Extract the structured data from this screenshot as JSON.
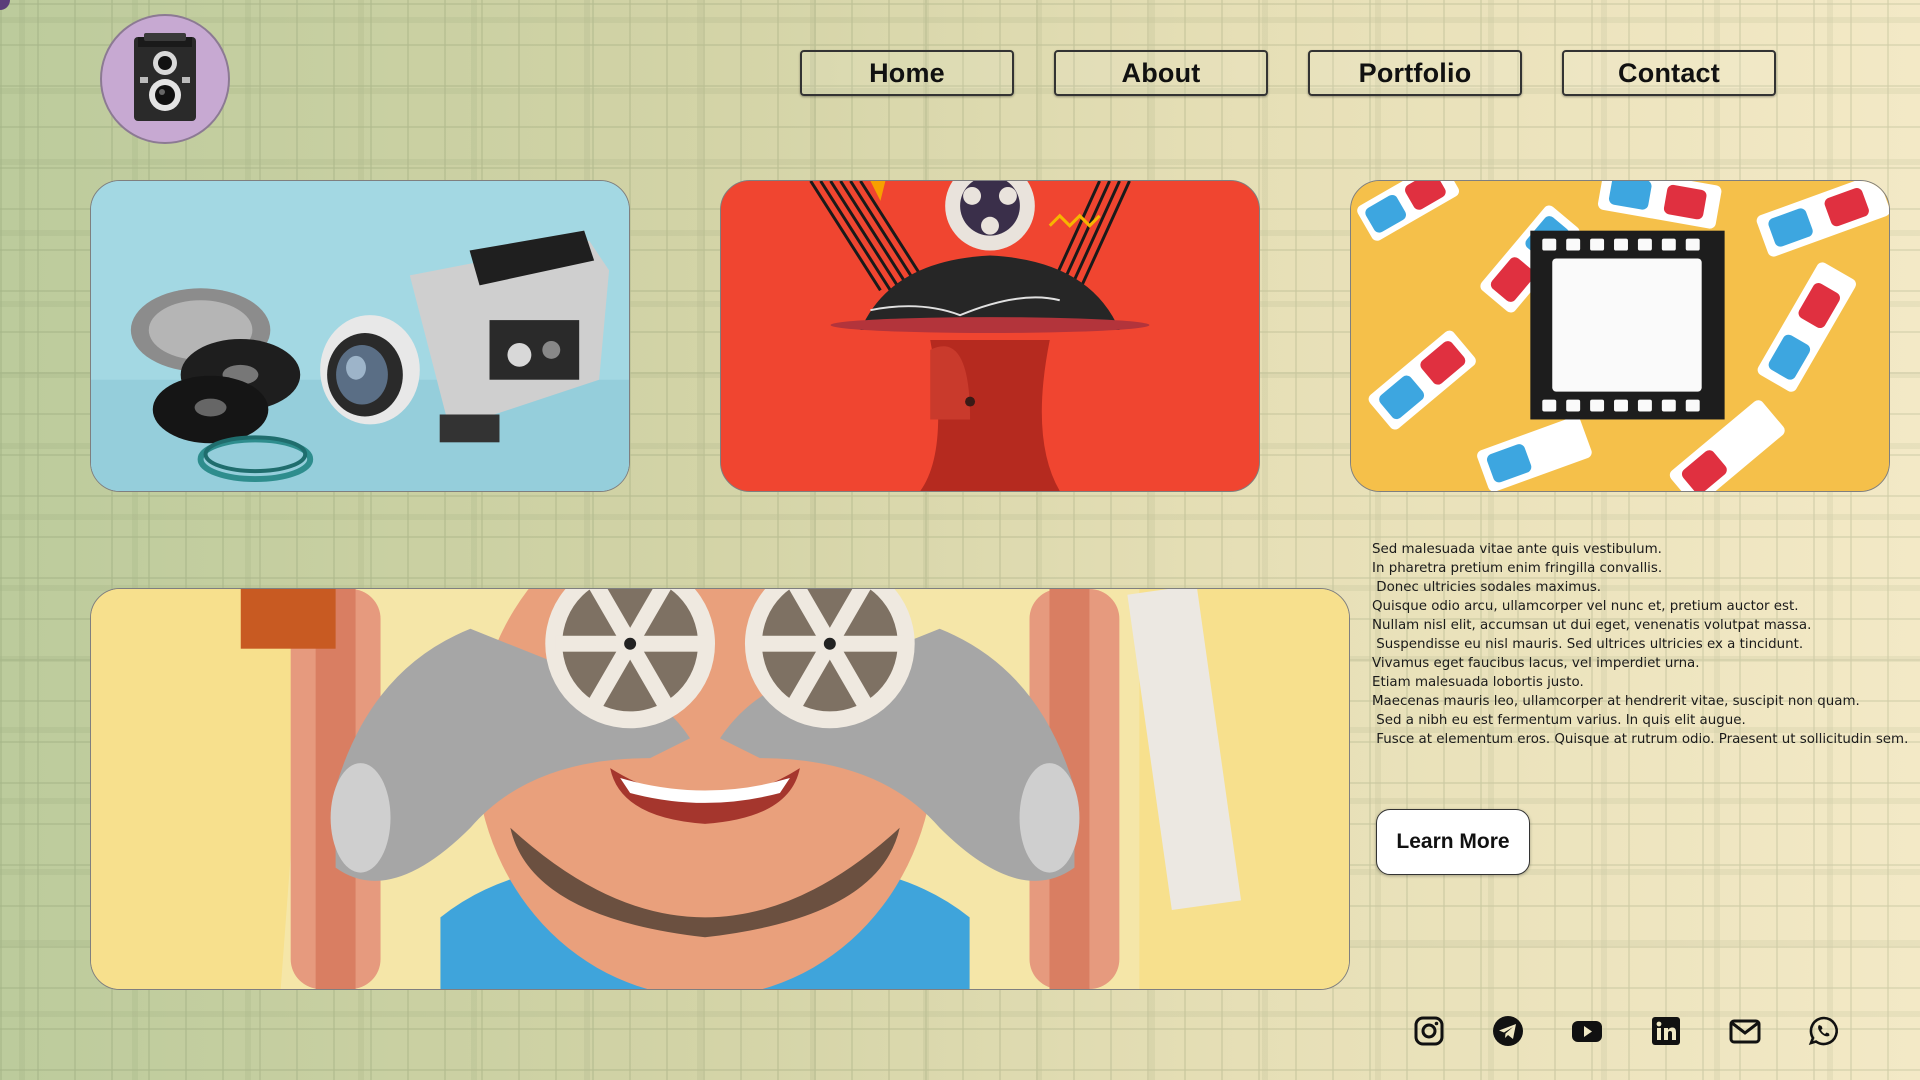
{
  "nav": {
    "items": [
      {
        "label": "Home"
      },
      {
        "label": "About"
      },
      {
        "label": "Portfolio"
      },
      {
        "label": "Contact"
      }
    ]
  },
  "logo": {
    "icon": "twin-lens-camera-icon"
  },
  "gallery": [
    {
      "icon": "movie-camera-icon"
    },
    {
      "icon": "film-reel-collage-icon"
    },
    {
      "icon": "film-strip-3d-glasses-icon"
    },
    {
      "icon": "man-with-film-reels-icon"
    }
  ],
  "intro": {
    "text": "Sed malesuada vitae ante quis vestibulum.\nIn pharetra pretium enim fringilla convallis.\n Donec ultricies sodales maximus.\nQuisque odio arcu, ullamcorper vel nunc et, pretium auctor est.\nNullam nisl elit, accumsan ut dui eget, venenatis volutpat massa.\n Suspendisse eu nisl mauris. Sed ultrices ultricies ex a tincidunt.\nVivamus eget faucibus lacus, vel imperdiet urna.\nEtiam malesuada lobortis justo.\nMaecenas mauris leo, ullamcorper at hendrerit vitae, suscipit non quam.\n Sed a nibh eu est fermentum varius. In quis elit augue.\n Fusce at elementum eros. Quisque at rutrum odio. Praesent ut sollicitudin sem.",
    "button_label": "Learn More"
  },
  "social": [
    {
      "icon": "instagram-icon"
    },
    {
      "icon": "telegram-icon"
    },
    {
      "icon": "youtube-icon"
    },
    {
      "icon": "linkedin-icon"
    },
    {
      "icon": "email-icon"
    },
    {
      "icon": "whatsapp-icon"
    }
  ],
  "colors": {
    "accent_purple": "#c7a9d2",
    "card_red": "#f04530",
    "card_blue": "#9fd6e2",
    "card_yellow": "#f5c04a"
  }
}
